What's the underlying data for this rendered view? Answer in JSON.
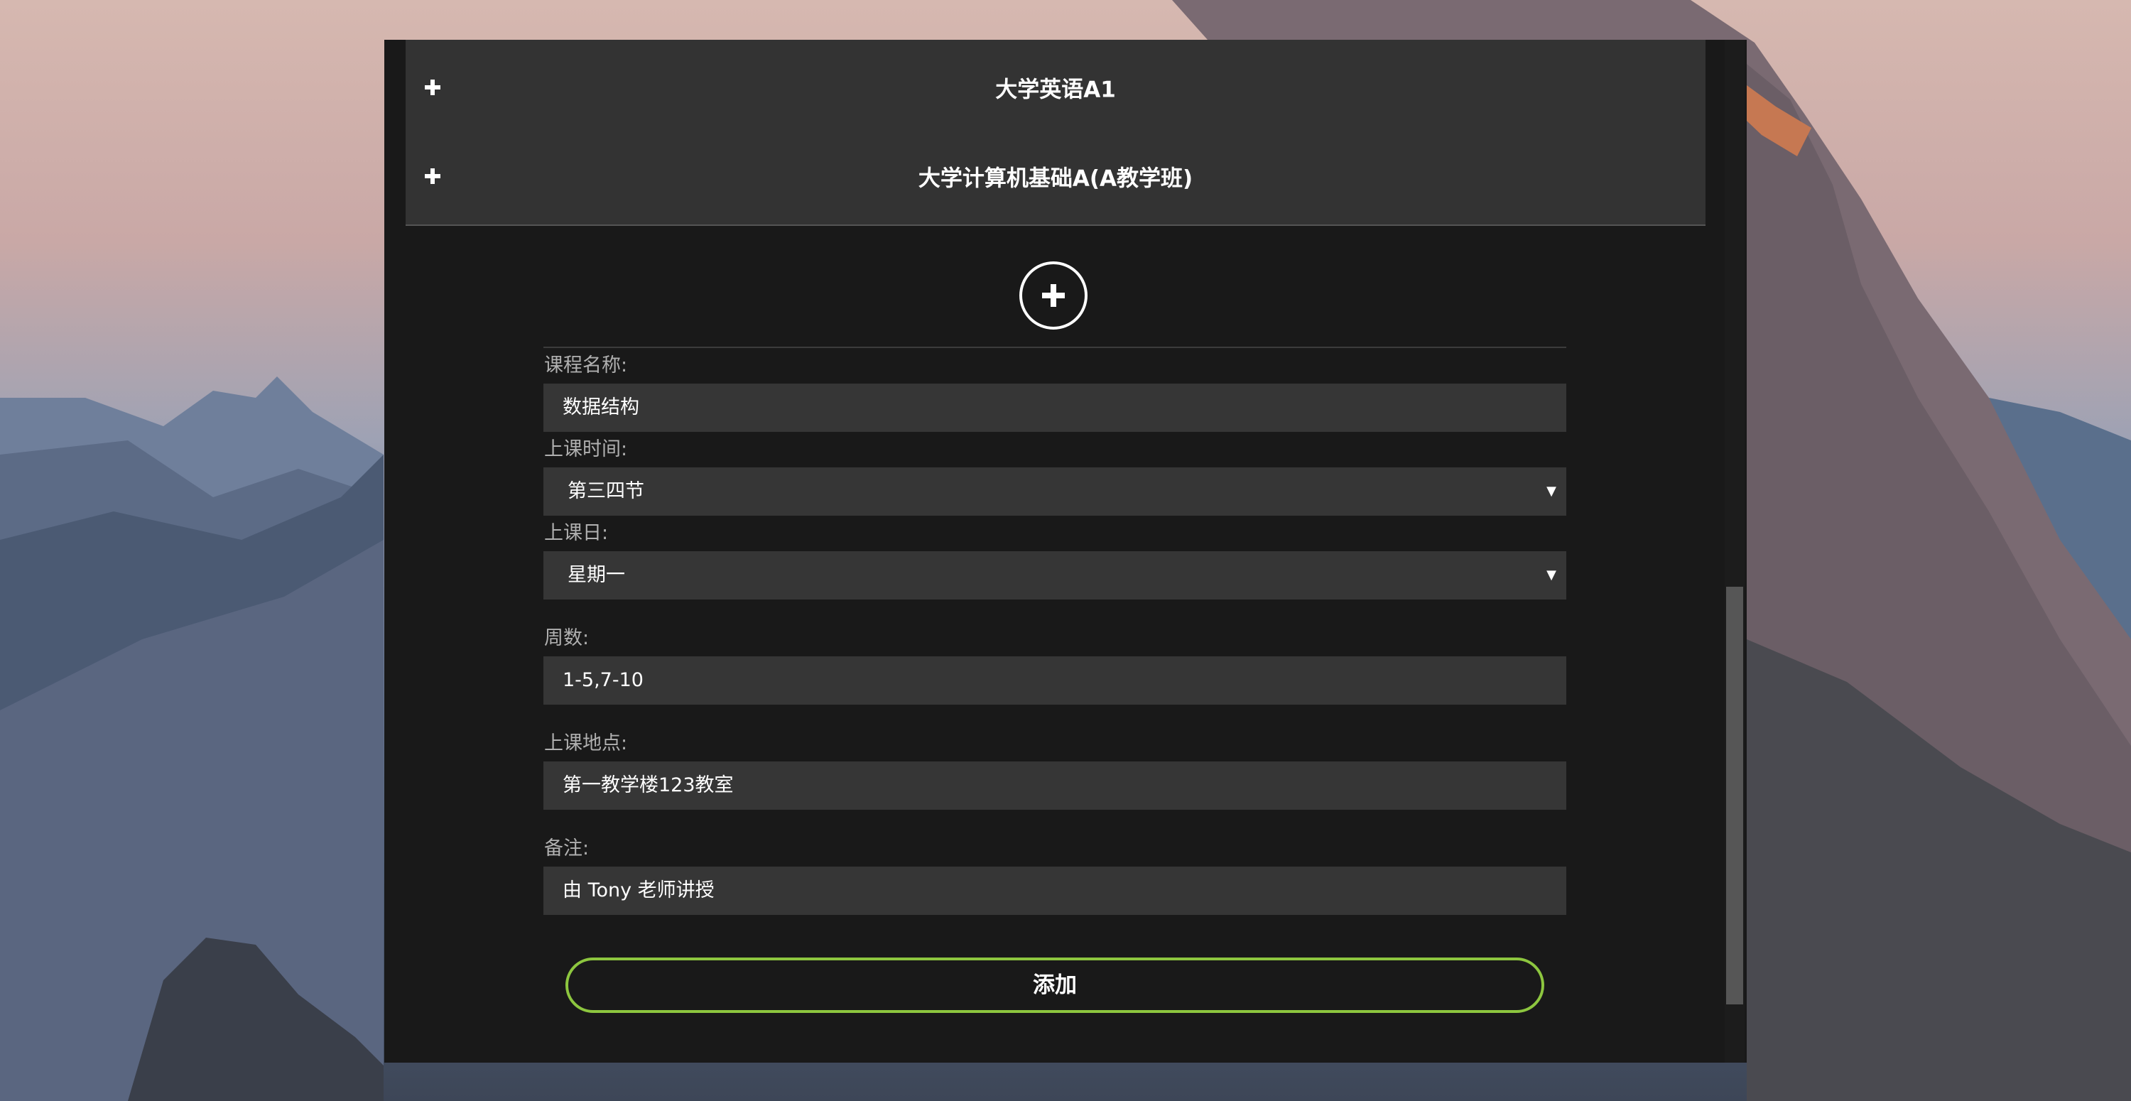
{
  "courses": [
    {
      "title": "大学英语A1"
    },
    {
      "title": "大学计算机基础A(A教学班)"
    }
  ],
  "form": {
    "name_label": "课程名称:",
    "name_value": "数据结构",
    "time_label": "上课时间:",
    "time_value": "第三四节",
    "day_label": "上课日:",
    "day_value": "星期一",
    "weeks_label": "周数:",
    "weeks_value": "1-5,7-10",
    "location_label": "上课地点:",
    "location_value": "第一教学楼123教室",
    "note_label": "备注:",
    "note_value": "由 Tony 老师讲授",
    "submit_label": "添加"
  },
  "icons": {
    "expand": "plus-icon",
    "add_course": "plus-circle-icon",
    "select_arrow": "caret-down-icon"
  },
  "colors": {
    "panel": "#191919",
    "field": "#363636",
    "accordion": "#333333",
    "submit_border": "#8dc63f"
  }
}
